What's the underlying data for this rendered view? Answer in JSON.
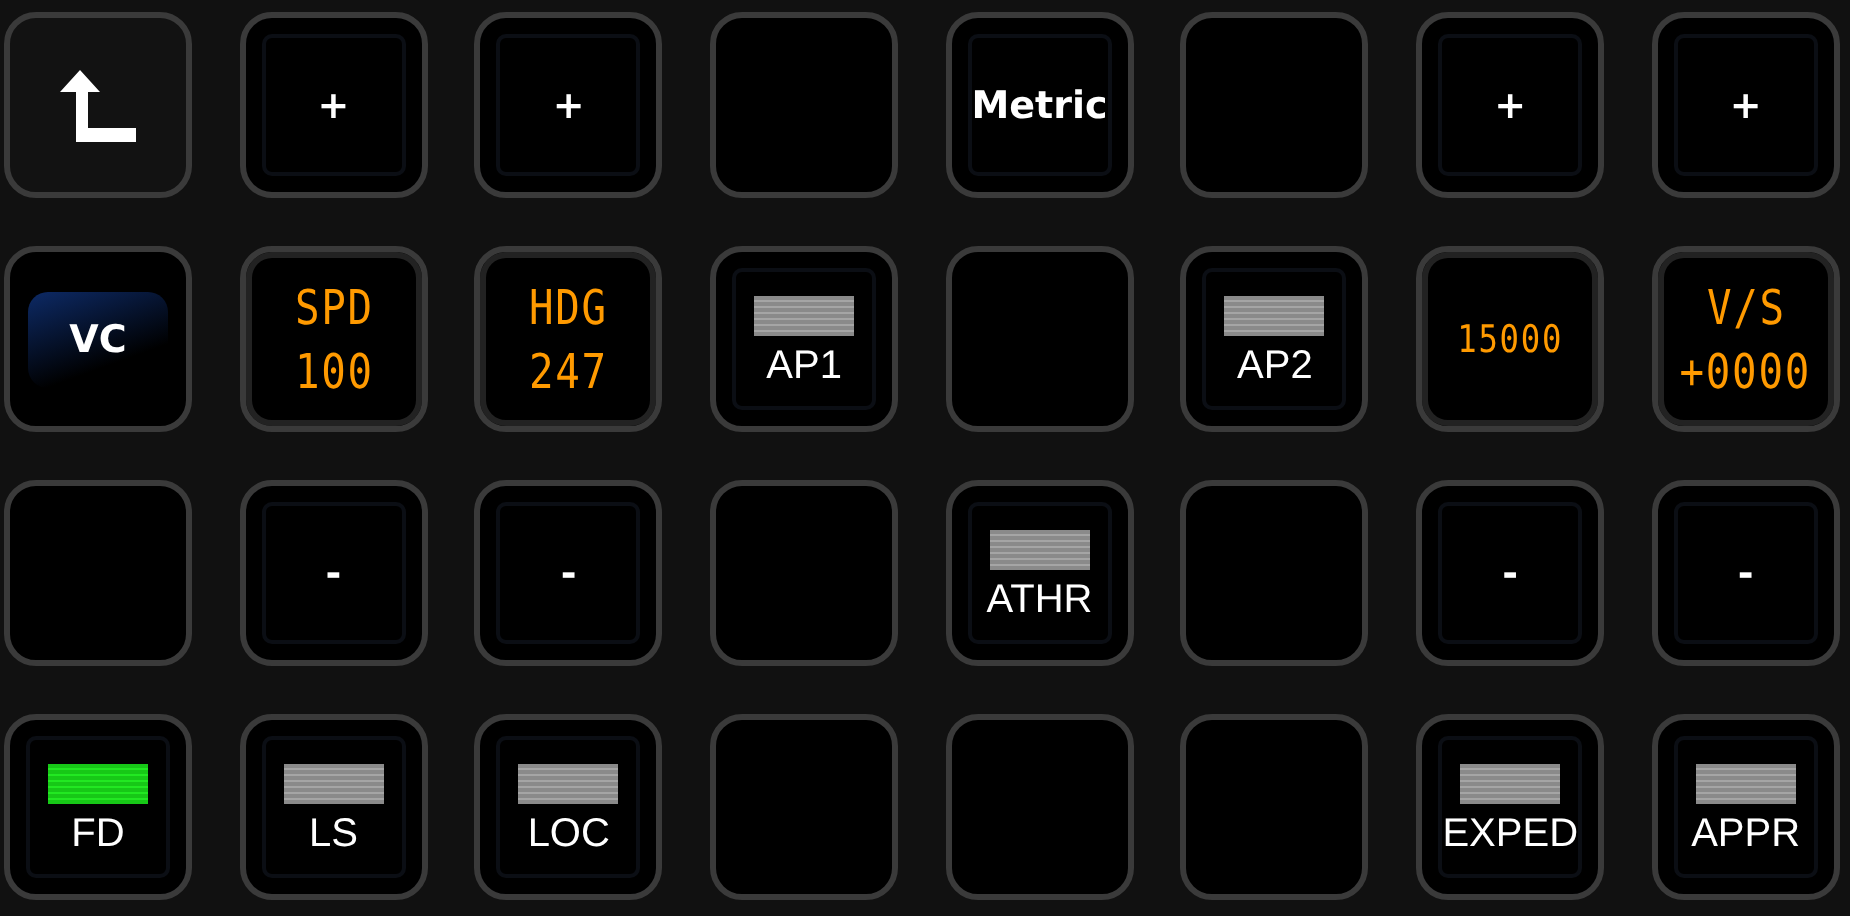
{
  "keys": [
    {
      "kind": "back"
    },
    {
      "kind": "text",
      "label": "+"
    },
    {
      "kind": "text",
      "label": "+"
    },
    {
      "kind": "blank"
    },
    {
      "kind": "text",
      "label": "Metric"
    },
    {
      "kind": "blank"
    },
    {
      "kind": "text",
      "label": "+"
    },
    {
      "kind": "text",
      "label": "+"
    },
    {
      "kind": "badge",
      "label": "VC"
    },
    {
      "kind": "display",
      "lines": [
        "SPD",
        "100"
      ]
    },
    {
      "kind": "display",
      "lines": [
        "HDG",
        "247"
      ]
    },
    {
      "kind": "light",
      "label": "AP1",
      "on": false
    },
    {
      "kind": "blank"
    },
    {
      "kind": "light",
      "label": "AP2",
      "on": false
    },
    {
      "kind": "display",
      "lines": [
        "15000"
      ]
    },
    {
      "kind": "display",
      "lines": [
        "V/S",
        "+0000"
      ]
    },
    {
      "kind": "blank"
    },
    {
      "kind": "text",
      "label": "-"
    },
    {
      "kind": "text",
      "label": "-"
    },
    {
      "kind": "blank"
    },
    {
      "kind": "light",
      "label": "ATHR",
      "on": false
    },
    {
      "kind": "blank"
    },
    {
      "kind": "text",
      "label": "-"
    },
    {
      "kind": "text",
      "label": "-"
    },
    {
      "kind": "light",
      "label": "FD",
      "on": true
    },
    {
      "kind": "light",
      "label": "LS",
      "on": false
    },
    {
      "kind": "light",
      "label": "LOC",
      "on": false
    },
    {
      "kind": "blank"
    },
    {
      "kind": "blank"
    },
    {
      "kind": "blank"
    },
    {
      "kind": "light",
      "label": "EXPED",
      "on": false
    },
    {
      "kind": "light",
      "label": "APPR",
      "on": false
    }
  ]
}
